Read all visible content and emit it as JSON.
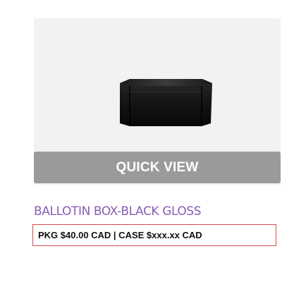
{
  "product": {
    "image_icon": "black-ballotin-box-image",
    "quick_view_label": "QUICK VIEW",
    "title": "BALLOTIN BOX-BLACK GLOSS",
    "price_line": "PKG $40.00 CAD | CASE $xxx.xx CAD"
  },
  "colors": {
    "image_background": "#f2f2f2",
    "quick_view_background": "#9a9a9a",
    "title": "#8a5cb3",
    "price_border": "#d94a4a"
  }
}
